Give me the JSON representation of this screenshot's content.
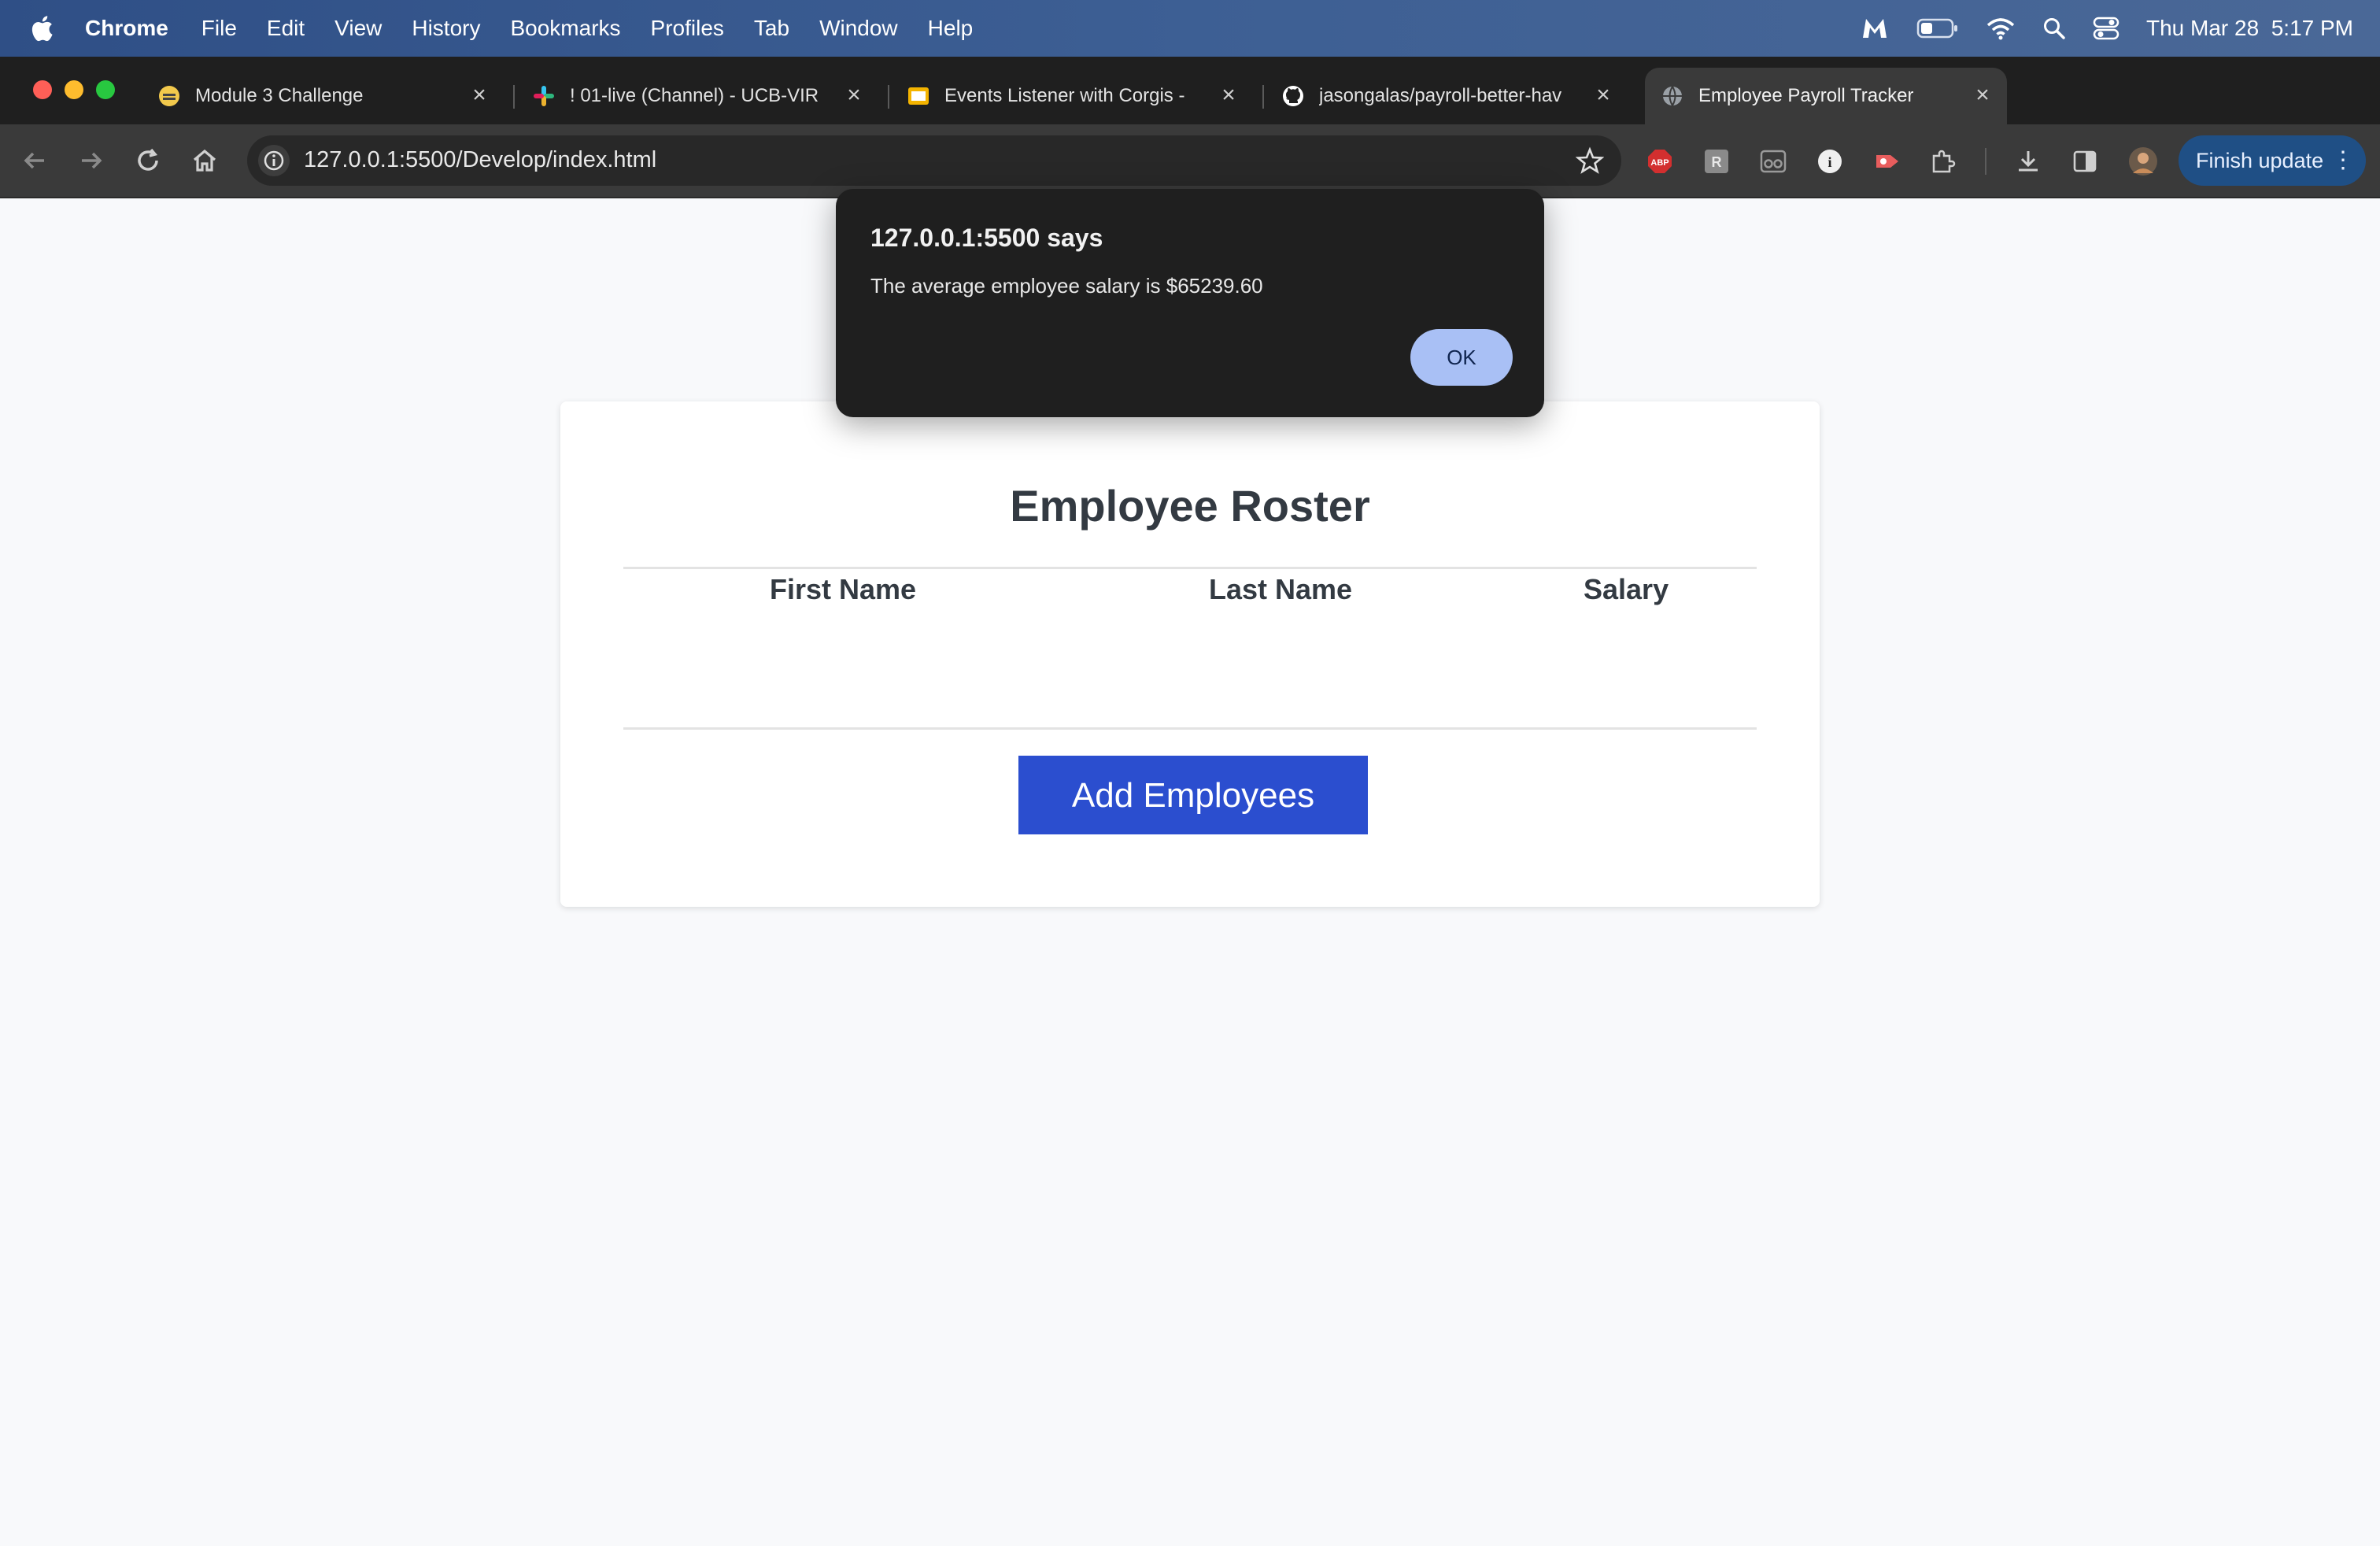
{
  "menubar": {
    "app_name": "Chrome",
    "menus": [
      "File",
      "Edit",
      "View",
      "History",
      "Bookmarks",
      "Profiles",
      "Tab",
      "Window",
      "Help"
    ],
    "clock": "Thu Mar 28  5:17 PM"
  },
  "tabs": [
    {
      "title": "Module 3 Challenge",
      "icon": "lesson-icon"
    },
    {
      "title": "! 01-live (Channel) - UCB-VIR",
      "icon": "slack-icon"
    },
    {
      "title": "Events Listener with Corgis -",
      "icon": "slides-icon"
    },
    {
      "title": "jasongalas/payroll-better-hav",
      "icon": "github-icon"
    },
    {
      "title": "Employee Payroll Tracker",
      "icon": "globe-icon",
      "active": true
    }
  ],
  "address_bar": {
    "url": "127.0.0.1:5500/Develop/index.html"
  },
  "toolbar": {
    "finish_update_label": "Finish update"
  },
  "page": {
    "heading": "Employee Roster",
    "columns": [
      "First Name",
      "Last Name",
      "Salary"
    ],
    "add_button_label": "Add Employees"
  },
  "dialog": {
    "origin": "127.0.0.1:5500 says",
    "message": "The average employee salary is $65239.60",
    "ok_label": "OK"
  },
  "colors": {
    "menubar": "#3d5f94",
    "dialog_bg": "#1f1f1f",
    "ok_button": "#a9c0f5",
    "add_button": "#2b4ecf",
    "finish_update": "#1f4f85"
  }
}
